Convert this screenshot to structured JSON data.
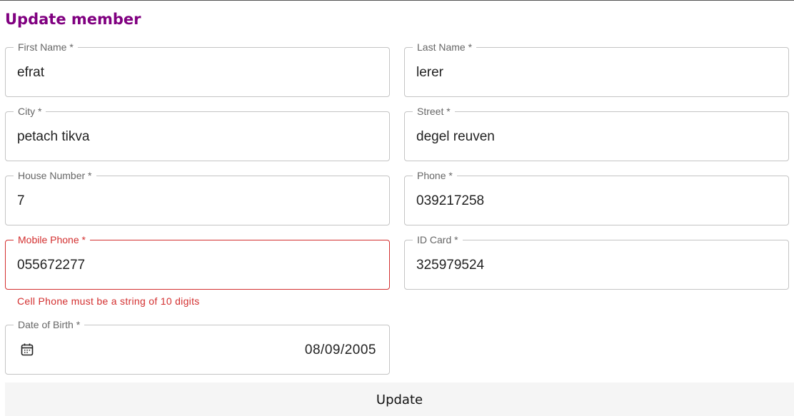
{
  "form": {
    "title": "Update member",
    "error_color": "#d32f2f",
    "title_color": "#800080",
    "fields": {
      "first_name": {
        "label": "First Name *",
        "value": "efrat"
      },
      "last_name": {
        "label": "Last Name *",
        "value": "lerer"
      },
      "city": {
        "label": "City *",
        "value": "petach tikva"
      },
      "street": {
        "label": "Street *",
        "value": "degel reuven"
      },
      "house_number": {
        "label": "House Number *",
        "value": "7"
      },
      "phone": {
        "label": "Phone *",
        "value": "039217258"
      },
      "mobile_phone": {
        "label": "Mobile Phone *",
        "value": "055672277",
        "error": "Cell Phone must be a string of 10 digits"
      },
      "id_card": {
        "label": "ID Card *",
        "value": "325979524"
      },
      "date_of_birth": {
        "label": "Date of Birth *",
        "value": "08/09/2005",
        "icon": "calendar-icon"
      }
    },
    "submit_label": "Update"
  }
}
